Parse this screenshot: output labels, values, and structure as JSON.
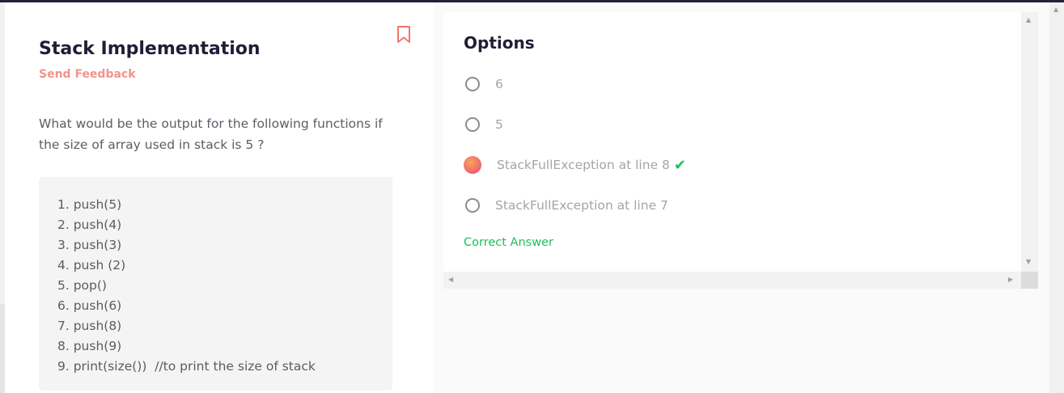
{
  "question": {
    "title": "Stack Implementation",
    "feedback_label": "Send Feedback",
    "text": "What would be the output for the following functions if the size of array used in stack is 5 ?",
    "code_lines": [
      "1. push(5)",
      "2. push(4)",
      "3. push(3)",
      "4. push (2)",
      "5. pop()",
      "6. push(6)",
      "7. push(8)",
      "8. push(9)",
      "9. print(size())  //to print the size of stack"
    ]
  },
  "options": {
    "title": "Options",
    "items": [
      {
        "label": "6",
        "selected": false,
        "correct": false
      },
      {
        "label": "5",
        "selected": false,
        "correct": false
      },
      {
        "label": "StackFullException at line 8",
        "selected": true,
        "correct": true
      },
      {
        "label": "StackFullException at line 7",
        "selected": false,
        "correct": false
      }
    ],
    "result_label": "Correct Answer"
  },
  "icons": {
    "bookmark": "bookmark-icon",
    "check": "check-icon",
    "scroll_up": "arrow-up-icon",
    "scroll_down": "arrow-down-icon",
    "scroll_left": "arrow-left-icon",
    "scroll_right": "arrow-right-icon"
  },
  "colors": {
    "accent_feedback": "#f3938a",
    "correct": "#1fbf5a",
    "title": "#1e1f36",
    "topbar": "#23213a"
  }
}
